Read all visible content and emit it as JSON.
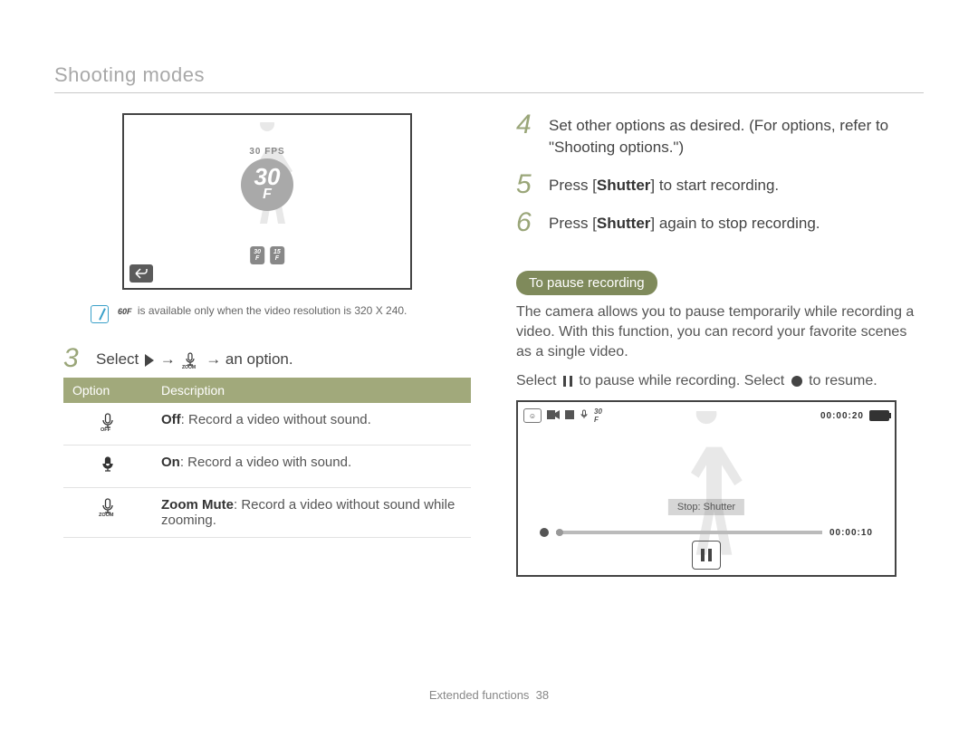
{
  "section_title": "Shooting modes",
  "left_screen": {
    "fps_label": "30 FPS",
    "fps_big": "30",
    "fps_f": "F",
    "small_30": "30",
    "small_15": "15"
  },
  "note": {
    "prefix_icon_label": "60F",
    "text": "is available only when the video resolution is 320 X 240."
  },
  "step3": {
    "num": "3",
    "pre": "Select",
    "arrow1": "→",
    "arrow2": "→",
    "post": "an option."
  },
  "options_table": {
    "head_option": "Option",
    "head_desc": "Description",
    "rows": [
      {
        "label": "Off",
        "desc": ": Record a video without sound."
      },
      {
        "label": "On",
        "desc": ": Record a video with sound."
      },
      {
        "label": "Zoom Mute",
        "desc": ": Record a video without sound while zooming."
      }
    ]
  },
  "step4": {
    "num": "4",
    "text": "Set other options as desired. (For options, refer to \"Shooting options.\")"
  },
  "step5": {
    "num": "5",
    "pre": "Press [",
    "bold": "Shutter",
    "post": "] to start recording."
  },
  "step6": {
    "num": "6",
    "pre": "Press [",
    "bold": "Shutter",
    "post": "] again to stop recording."
  },
  "pause_section": {
    "pill": "To pause recording",
    "para": "The camera allows you to pause temporarily while recording a video. With this function, you can record your favorite scenes as a single video.",
    "select_pre": "Select",
    "select_mid": "to pause while recording. Select",
    "select_post": "to resume."
  },
  "screen2": {
    "time_total": "00:00:20",
    "stop_label": "Stop: Shutter",
    "time_elapsed": "00:00:10"
  },
  "footer": {
    "label": "Extended functions",
    "page": "38"
  }
}
